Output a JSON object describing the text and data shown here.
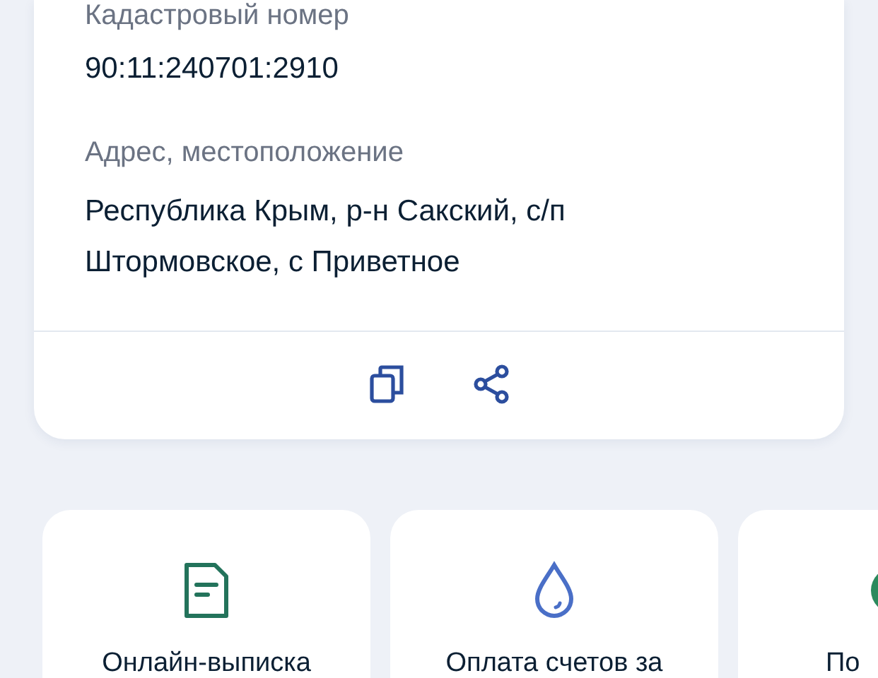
{
  "property_card": {
    "cadastral_label": "Кадастровый номер",
    "cadastral_number": "90:11:240701:2910",
    "address_label": "Адрес, местоположение",
    "address": "Республика Крым, р-н Сакский, с/п Штормовское, с Приветное"
  },
  "services": [
    {
      "kind": "document",
      "title": "Онлайн-выписка"
    },
    {
      "kind": "water",
      "title": "Оплата счетов за"
    },
    {
      "kind": "other",
      "title": "По"
    }
  ]
}
